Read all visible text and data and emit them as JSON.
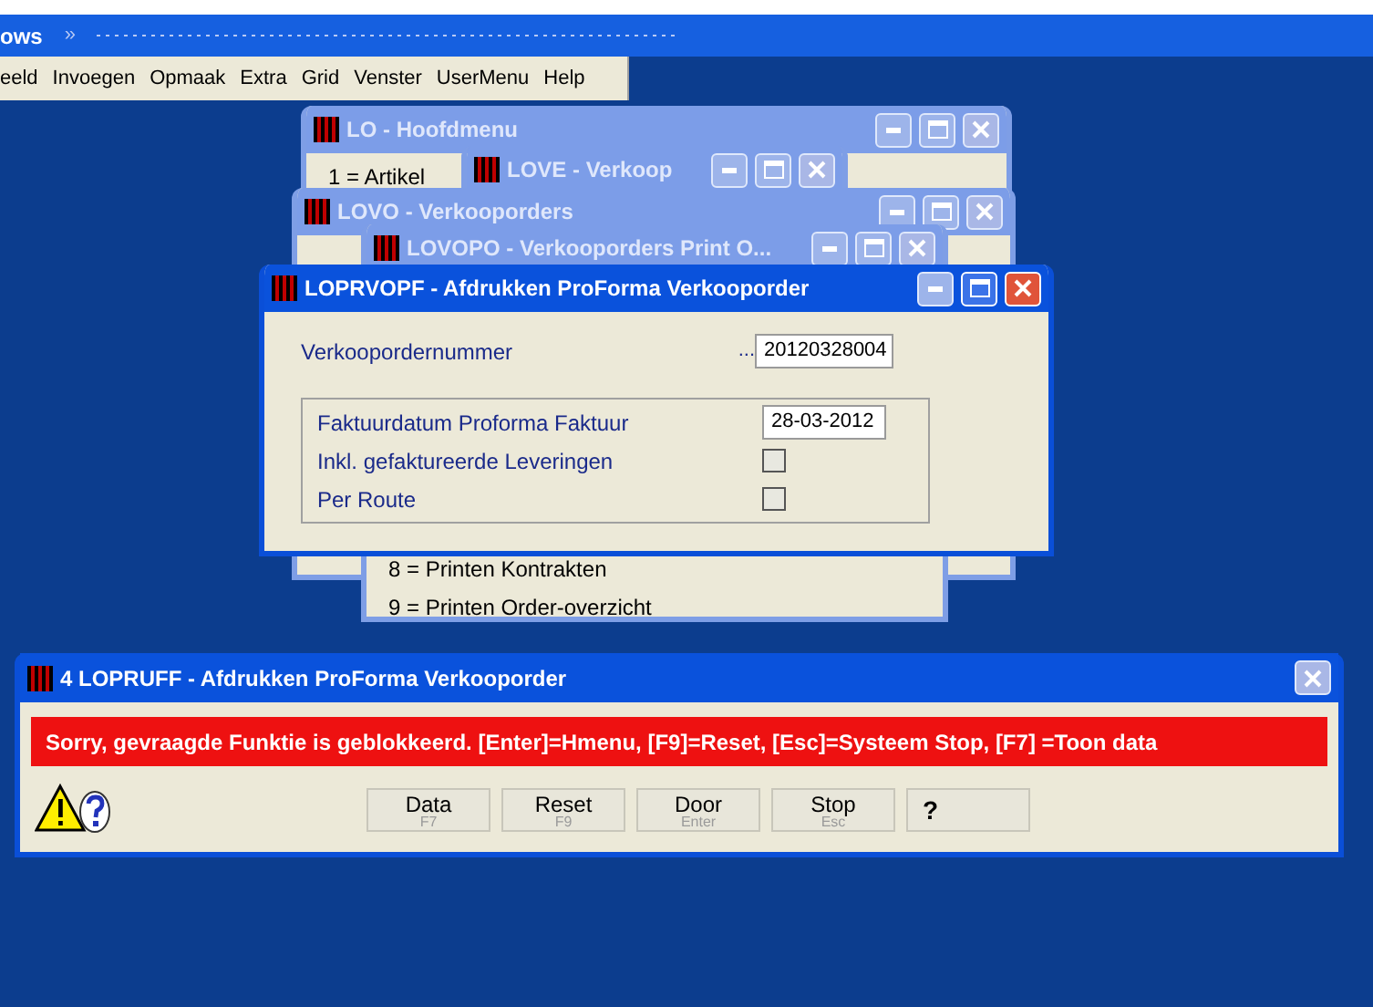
{
  "app_title": {
    "text": "ows",
    "chevron": "»"
  },
  "menu": [
    "eeld",
    "Invoegen",
    "Opmaak",
    "Extra",
    "Grid",
    "Venster",
    "UserMenu",
    "Help"
  ],
  "windows": [
    {
      "title": "LO - Hoofdmenu",
      "active": false,
      "lines": [
        "1 = Artikel"
      ]
    },
    {
      "title": "LOVE - Verkoop",
      "active": false
    },
    {
      "title": "LOVO - Verkooporders",
      "active": false
    },
    {
      "title": "LOVOPO - Verkooporders Print O...",
      "active": false,
      "lines": [
        "8 = Printen Kontrakten",
        "9 = Printen Order-overzicht"
      ]
    },
    {
      "title": "LOPRVOPF - Afdrukken ProForma Verkooporder",
      "active": true
    }
  ],
  "form": {
    "order_label": "Verkoopordernummer",
    "order_dots": "...",
    "order_value": "20120328004",
    "fields": [
      {
        "kind": "input",
        "label": "Faktuurdatum Proforma Faktuur",
        "value": "28-03-2012"
      },
      {
        "kind": "checkbox",
        "label": "Inkl. gefaktureerde Leveringen",
        "checked": false
      },
      {
        "kind": "checkbox",
        "label": "Per Route",
        "checked": false
      }
    ]
  },
  "dialog": {
    "title": "4 LOPRUFF - Afdrukken ProForma Verkooporder",
    "message": "Sorry, gevraagde Funktie is geblokkeerd.  [Enter]=Hmenu, [F9]=Reset, [Esc]=Systeem Stop, [F7] =Toon data",
    "buttons": [
      {
        "label": "Data",
        "key": "F7"
      },
      {
        "label": "Reset",
        "key": "F9"
      },
      {
        "label": "Door",
        "key": "Enter"
      },
      {
        "label": "Stop",
        "key": "Esc"
      }
    ],
    "help_glyph": "?"
  }
}
